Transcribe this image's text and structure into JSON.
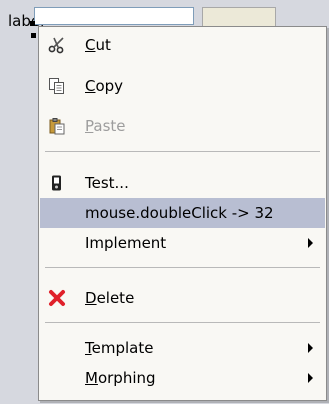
{
  "background": {
    "label_text": "label",
    "field_value": "",
    "button_label": ""
  },
  "context_menu": {
    "items": [
      {
        "label": "Cut",
        "mnemonic_first": "C",
        "icon": "scissors-icon",
        "enabled": true
      },
      {
        "label": "Copy",
        "mnemonic_first": "C",
        "icon": "copy-icon",
        "enabled": true
      },
      {
        "label": "Paste",
        "mnemonic_first": "P",
        "icon": "paste-icon",
        "enabled": false
      },
      {
        "label": "Test...",
        "icon": "test-icon",
        "enabled": true
      },
      {
        "label": "mouse.doubleClick -> 32",
        "enabled": true,
        "highlighted": true
      },
      {
        "label": "Implement",
        "enabled": true,
        "submenu": true
      },
      {
        "label": "Delete",
        "mnemonic_first": "D",
        "icon": "delete-icon",
        "enabled": true
      },
      {
        "label": "Template",
        "mnemonic_first": "T",
        "enabled": true,
        "submenu": true
      },
      {
        "label": "Morphing",
        "mnemonic_first": "M",
        "enabled": true,
        "submenu": true
      }
    ]
  },
  "colors": {
    "highlight": "#b8bed2",
    "menu_bg": "#f9f8f4",
    "disabled_text": "#9d9d9d",
    "delete_icon": "#e0202a"
  }
}
